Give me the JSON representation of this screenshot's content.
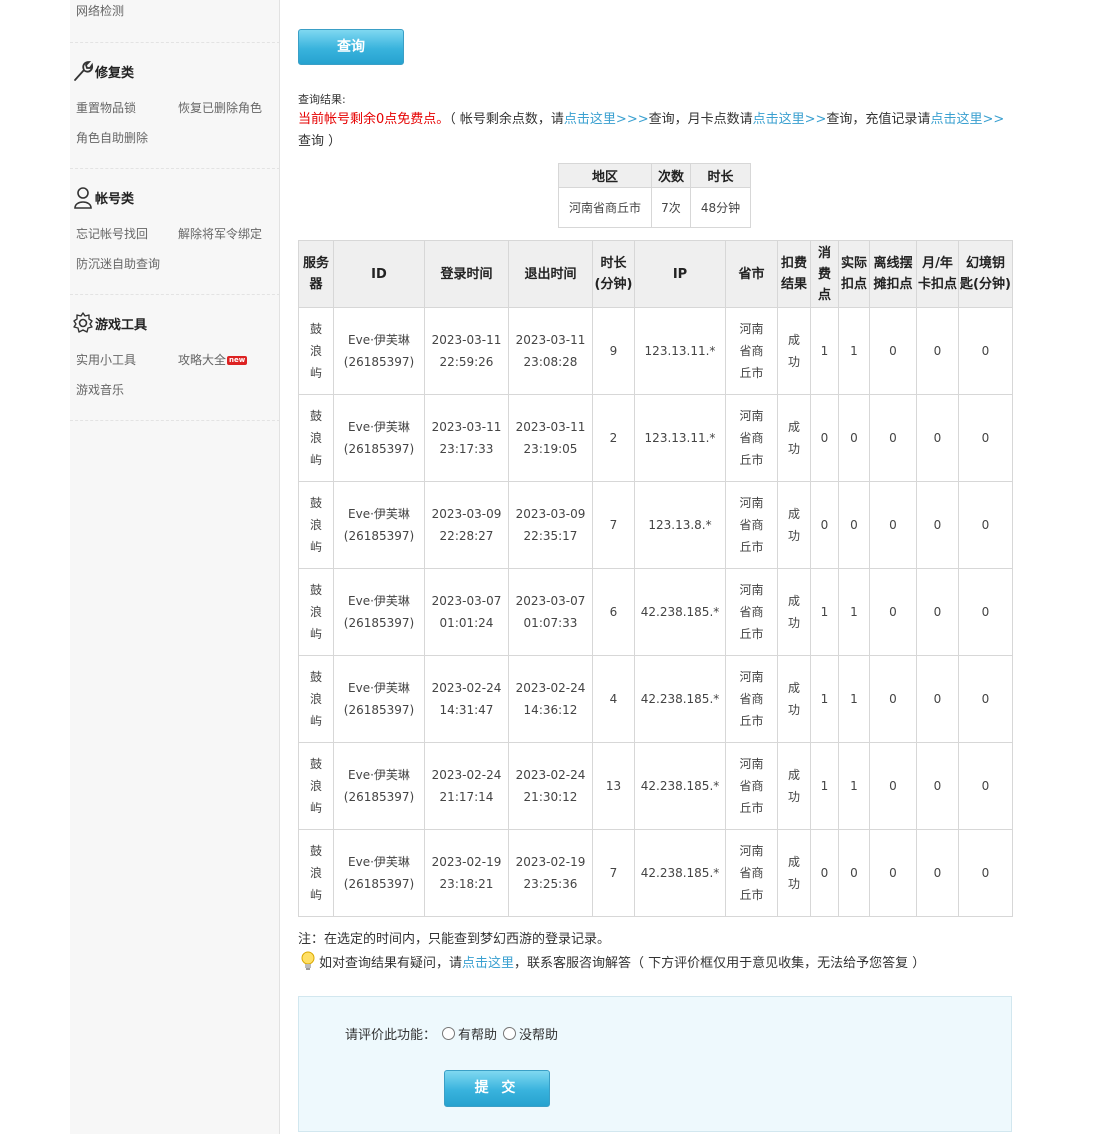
{
  "sidebar": {
    "top_link": "网络检测",
    "groups": [
      {
        "title": "修复类",
        "icon": "wrench-icon",
        "links": [
          [
            "重置物品锁",
            "恢复已删除角色"
          ],
          [
            "角色自助删除"
          ]
        ]
      },
      {
        "title": "帐号类",
        "icon": "user-icon",
        "links": [
          [
            "忘记帐号找回",
            "解除将军令绑定"
          ],
          [
            "防沉迷自助查询"
          ]
        ]
      },
      {
        "title": "游戏工具",
        "icon": "gear-icon",
        "links": [
          [
            "实用小工具",
            "攻略大全"
          ],
          [
            "游戏音乐"
          ]
        ],
        "badge": "new"
      }
    ]
  },
  "main": {
    "query_button": "查询",
    "result_label": "查询结果:",
    "notice": {
      "free_points": "当前帐号剩余0点免费点。",
      "p1": "（ 帐号剩余点数，请",
      "link1": "点击这里>>>",
      "p2": "查询，月卡点数请",
      "link2": "点击这里>>",
      "p3": "查询，充值记录请",
      "link3": "点击这里>>",
      "p4": "查询 ）"
    },
    "summary": {
      "headers": [
        "地区",
        "次数",
        "时长"
      ],
      "row": [
        "河南省商丘市",
        "7次",
        "48分钟"
      ]
    },
    "records": {
      "headers": [
        "服务器",
        "ID",
        "登录时间",
        "退出时间",
        "时长(分钟)",
        "IP",
        "省市",
        "扣费结果",
        "消费点",
        "实际扣点",
        "离线摆摊扣点",
        "月/年卡扣点",
        "幻境钥匙(分钟)"
      ],
      "rows": [
        {
          "server": "鼓浪屿",
          "id": "Eve·伊芙琳",
          "uid": "(26185397)",
          "login_d": "2023-03-11",
          "login_t": "22:59:26",
          "logout_d": "2023-03-11",
          "logout_t": "23:08:28",
          "duration": "9",
          "ip": "123.13.11.*",
          "city": "河南省商丘市",
          "result": "成功",
          "consume": "1",
          "actual": "1",
          "offline": "0",
          "card": "0",
          "key": "0"
        },
        {
          "server": "鼓浪屿",
          "id": "Eve·伊芙琳",
          "uid": "(26185397)",
          "login_d": "2023-03-11",
          "login_t": "23:17:33",
          "logout_d": "2023-03-11",
          "logout_t": "23:19:05",
          "duration": "2",
          "ip": "123.13.11.*",
          "city": "河南省商丘市",
          "result": "成功",
          "consume": "0",
          "actual": "0",
          "offline": "0",
          "card": "0",
          "key": "0"
        },
        {
          "server": "鼓浪屿",
          "id": "Eve·伊芙琳",
          "uid": "(26185397)",
          "login_d": "2023-03-09",
          "login_t": "22:28:27",
          "logout_d": "2023-03-09",
          "logout_t": "22:35:17",
          "duration": "7",
          "ip": "123.13.8.*",
          "city": "河南省商丘市",
          "result": "成功",
          "consume": "0",
          "actual": "0",
          "offline": "0",
          "card": "0",
          "key": "0"
        },
        {
          "server": "鼓浪屿",
          "id": "Eve·伊芙琳",
          "uid": "(26185397)",
          "login_d": "2023-03-07",
          "login_t": "01:01:24",
          "logout_d": "2023-03-07",
          "logout_t": "01:07:33",
          "duration": "6",
          "ip": "42.238.185.*",
          "city": "河南省商丘市",
          "result": "成功",
          "consume": "1",
          "actual": "1",
          "offline": "0",
          "card": "0",
          "key": "0"
        },
        {
          "server": "鼓浪屿",
          "id": "Eve·伊芙琳",
          "uid": "(26185397)",
          "login_d": "2023-02-24",
          "login_t": "14:31:47",
          "logout_d": "2023-02-24",
          "logout_t": "14:36:12",
          "duration": "4",
          "ip": "42.238.185.*",
          "city": "河南省商丘市",
          "result": "成功",
          "consume": "1",
          "actual": "1",
          "offline": "0",
          "card": "0",
          "key": "0"
        },
        {
          "server": "鼓浪屿",
          "id": "Eve·伊芙琳",
          "uid": "(26185397)",
          "login_d": "2023-02-24",
          "login_t": "21:17:14",
          "logout_d": "2023-02-24",
          "logout_t": "21:30:12",
          "duration": "13",
          "ip": "42.238.185.*",
          "city": "河南省商丘市",
          "result": "成功",
          "consume": "1",
          "actual": "1",
          "offline": "0",
          "card": "0",
          "key": "0"
        },
        {
          "server": "鼓浪屿",
          "id": "Eve·伊芙琳",
          "uid": "(26185397)",
          "login_d": "2023-02-19",
          "login_t": "23:18:21",
          "logout_d": "2023-02-19",
          "logout_t": "23:25:36",
          "duration": "7",
          "ip": "42.238.185.*",
          "city": "河南省商丘市",
          "result": "成功",
          "consume": "0",
          "actual": "0",
          "offline": "0",
          "card": "0",
          "key": "0"
        }
      ]
    },
    "note": "注：在选定的时间内，只能查到梦幻西游的登录记录。",
    "help": {
      "pre": "如对查询结果有疑问，请",
      "link": "点击这里",
      "post": "，联系客服咨询解答（ 下方评价框仅用于意见收集，无法给予您答复 ）"
    },
    "feedback": {
      "label": "请评价此功能：",
      "opt_yes": "有帮助",
      "opt_no": "没帮助",
      "submit": "提 交"
    }
  },
  "colors": {
    "accent": "#39b3dd",
    "link": "#3aa0d0",
    "warning": "#e60000",
    "feedback_bg": "#eef9fd"
  }
}
